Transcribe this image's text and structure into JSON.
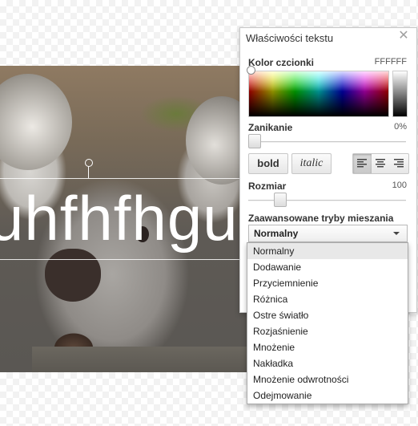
{
  "panel": {
    "title": "Właściwości tekstu",
    "close_glyph": "✕",
    "font_color": {
      "label": "Kolor czcionki",
      "value": "FFFFFF"
    },
    "fade": {
      "label": "Zanikanie",
      "value": "0%",
      "level": 0
    },
    "buttons": {
      "bold": "bold",
      "italic": "italic"
    },
    "alignment": [
      "left",
      "center",
      "right"
    ],
    "alignment_active": "left",
    "size": {
      "label": "Rozmiar",
      "value": "100"
    },
    "blend": {
      "label": "Zaawansowane tryby mieszania",
      "selected": "Normalny",
      "options": [
        "Normalny",
        "Dodawanie",
        "Przyciemnienie",
        "Różnica",
        "Ostre światło",
        "Rozjaśnienie",
        "Mnożenie",
        "Nakładka",
        "Mnożenie odwrotności",
        "Odejmowanie"
      ]
    }
  },
  "canvas": {
    "text": "uhfhfhgu"
  },
  "colors": {
    "accent_selected": "#e8e8e8",
    "text_color": "#ffffff"
  }
}
